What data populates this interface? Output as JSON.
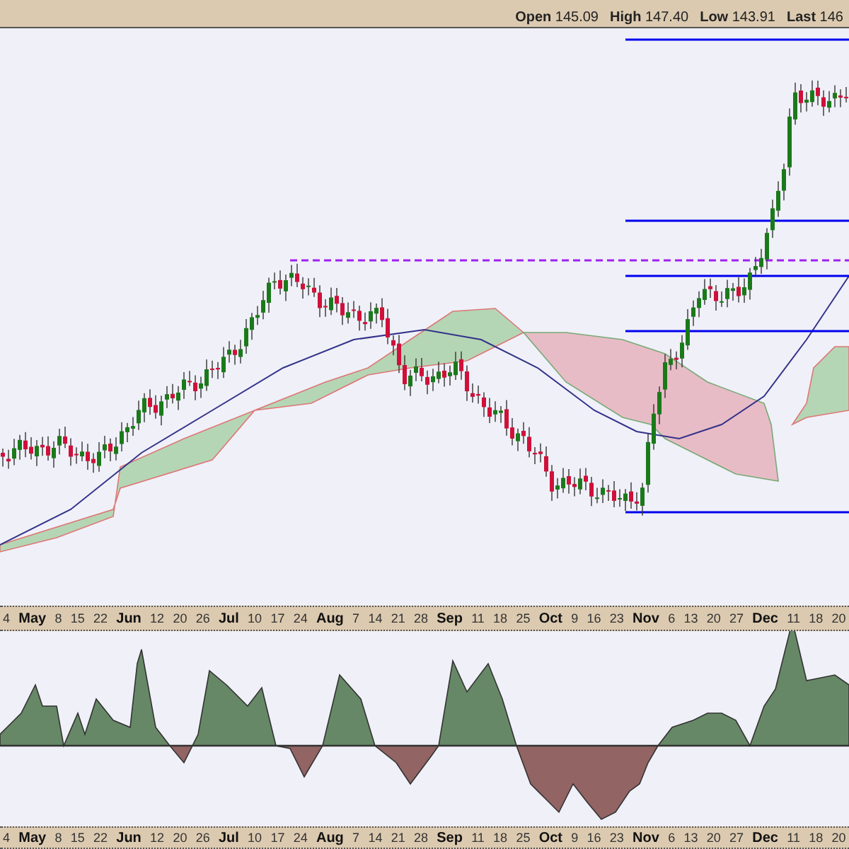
{
  "quote": [
    {
      "label": "Open",
      "value": "145.09"
    },
    {
      "label": "High",
      "value": "147.40"
    },
    {
      "label": "Low",
      "value": "143.91"
    },
    {
      "label": "Last",
      "value": "146"
    }
  ],
  "date_axis_top": {
    "labels": [
      {
        "text": "4",
        "kind": "day"
      },
      {
        "text": "May",
        "kind": "month"
      },
      {
        "text": "8",
        "kind": "day"
      },
      {
        "text": "15",
        "kind": "day"
      },
      {
        "text": "22",
        "kind": "day"
      },
      {
        "text": "Jun",
        "kind": "month"
      },
      {
        "text": "12",
        "kind": "day"
      },
      {
        "text": "20",
        "kind": "day"
      },
      {
        "text": "26",
        "kind": "day"
      },
      {
        "text": "Jul",
        "kind": "month"
      },
      {
        "text": "10",
        "kind": "day"
      },
      {
        "text": "17",
        "kind": "day"
      },
      {
        "text": "24",
        "kind": "day"
      },
      {
        "text": "Aug",
        "kind": "month"
      },
      {
        "text": "7",
        "kind": "day"
      },
      {
        "text": "14",
        "kind": "day"
      },
      {
        "text": "21",
        "kind": "day"
      },
      {
        "text": "28",
        "kind": "day"
      },
      {
        "text": "Sep",
        "kind": "month"
      },
      {
        "text": "11",
        "kind": "day"
      },
      {
        "text": "18",
        "kind": "day"
      },
      {
        "text": "25",
        "kind": "day"
      },
      {
        "text": "Oct",
        "kind": "month"
      },
      {
        "text": "9",
        "kind": "day"
      },
      {
        "text": "16",
        "kind": "day"
      },
      {
        "text": "23",
        "kind": "day"
      },
      {
        "text": "Nov",
        "kind": "month"
      },
      {
        "text": "6",
        "kind": "day"
      },
      {
        "text": "13",
        "kind": "day"
      },
      {
        "text": "20",
        "kind": "day"
      },
      {
        "text": "27",
        "kind": "day"
      },
      {
        "text": "Dec",
        "kind": "month"
      },
      {
        "text": "11",
        "kind": "day"
      },
      {
        "text": "18",
        "kind": "day"
      },
      {
        "text": "20",
        "kind": "day"
      }
    ]
  },
  "date_axis_bottom": {
    "labels": [
      {
        "text": "4",
        "kind": "day"
      },
      {
        "text": "May",
        "kind": "month"
      },
      {
        "text": "8",
        "kind": "day"
      },
      {
        "text": "15",
        "kind": "day"
      },
      {
        "text": "22",
        "kind": "day"
      },
      {
        "text": "Jun",
        "kind": "month"
      },
      {
        "text": "12",
        "kind": "day"
      },
      {
        "text": "20",
        "kind": "day"
      },
      {
        "text": "26",
        "kind": "day"
      },
      {
        "text": "Jul",
        "kind": "month"
      },
      {
        "text": "10",
        "kind": "day"
      },
      {
        "text": "17",
        "kind": "day"
      },
      {
        "text": "24",
        "kind": "day"
      },
      {
        "text": "Aug",
        "kind": "month"
      },
      {
        "text": "7",
        "kind": "day"
      },
      {
        "text": "14",
        "kind": "day"
      },
      {
        "text": "21",
        "kind": "day"
      },
      {
        "text": "28",
        "kind": "day"
      },
      {
        "text": "Sep",
        "kind": "month"
      },
      {
        "text": "11",
        "kind": "day"
      },
      {
        "text": "18",
        "kind": "day"
      },
      {
        "text": "25",
        "kind": "day"
      },
      {
        "text": "Oct",
        "kind": "month"
      },
      {
        "text": "9",
        "kind": "day"
      },
      {
        "text": "16",
        "kind": "day"
      },
      {
        "text": "23",
        "kind": "day"
      },
      {
        "text": "Nov",
        "kind": "month"
      },
      {
        "text": "6",
        "kind": "day"
      },
      {
        "text": "13",
        "kind": "day"
      },
      {
        "text": "20",
        "kind": "day"
      },
      {
        "text": "27",
        "kind": "day"
      },
      {
        "text": "Dec",
        "kind": "month"
      },
      {
        "text": "11",
        "kind": "day"
      },
      {
        "text": "18",
        "kind": "day"
      },
      {
        "text": "20",
        "kind": "day"
      }
    ]
  }
}
